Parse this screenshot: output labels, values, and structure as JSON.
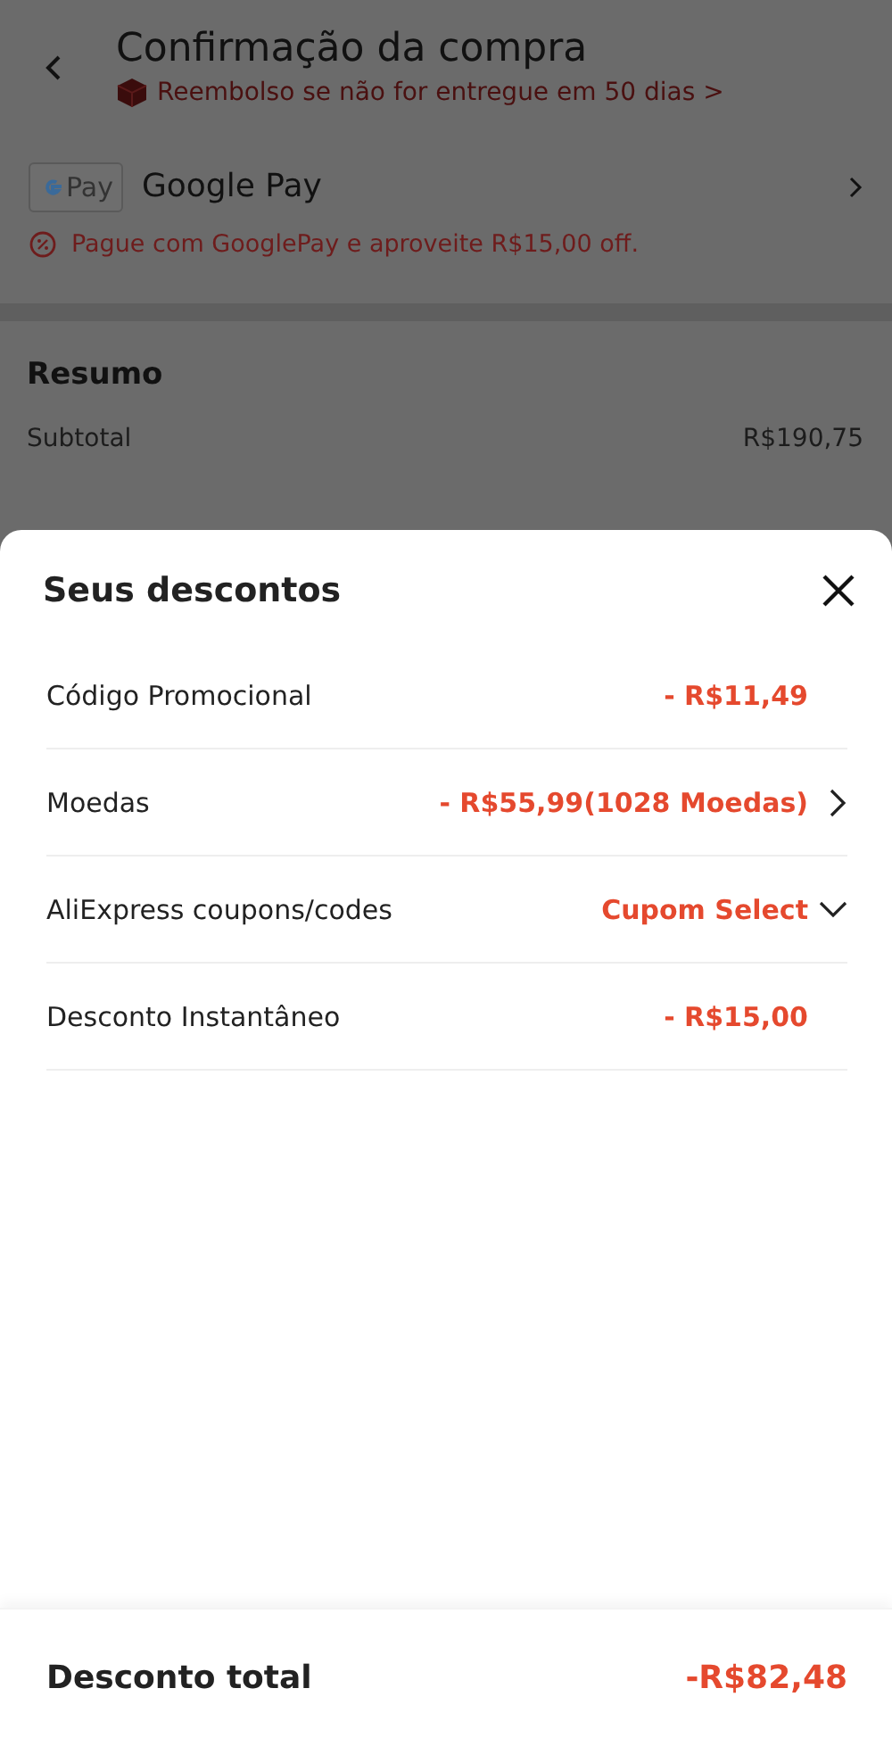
{
  "page": {
    "title": "Confirmação da compra",
    "refund_notice": "Reembolso se não for entregue em 50 dias >",
    "payment": {
      "logo_text": "Pay",
      "name": "Google Pay",
      "promo": "Pague com GooglePay e aproveite R$15,00 off."
    },
    "summary": {
      "title": "Resumo",
      "rows": [
        {
          "label": "Subtotal",
          "value": "R$190,75"
        }
      ]
    }
  },
  "sheet": {
    "title": "Seus descontos",
    "rows": [
      {
        "kind": "amount",
        "label": "Código Promocional",
        "value": "- R$11,49"
      },
      {
        "kind": "link",
        "label": "Moedas",
        "value": "- R$55,99(1028 Moedas)"
      },
      {
        "kind": "dropdown",
        "label": "AliExpress coupons/codes",
        "value": "Cupom Select"
      },
      {
        "kind": "amount",
        "label": "Desconto Instantâneo",
        "value": "- R$15,00"
      }
    ],
    "total": {
      "label": "Desconto total",
      "value": "-R$82,48"
    }
  }
}
